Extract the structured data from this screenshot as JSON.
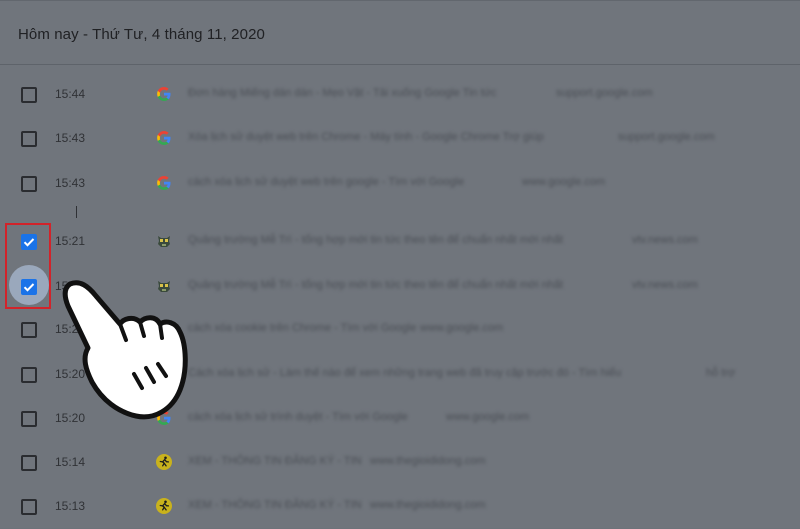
{
  "header": {
    "title": "Hôm nay - Thứ Tư, 4 tháng 11, 2020"
  },
  "rows": [
    {
      "time": "15:44",
      "checked": false,
      "icon": "google-icon",
      "title": "Đơn hàng Miếng dán dán - Mẹo Vặt - Tải xuống Google Tin tức",
      "domain": "support.google.com"
    },
    {
      "time": "15:43",
      "checked": false,
      "icon": "google-icon",
      "title": "Xóa lịch sử duyệt web trên Chrome - Máy tính - Google Chrome Trợ giúp",
      "domain": "support.google.com"
    },
    {
      "time": "15:43",
      "checked": false,
      "icon": "google-icon",
      "title": "cách xóa lịch sử duyệt web trên google - Tìm với Google",
      "domain": "www.google.com"
    },
    {
      "time": "15:21",
      "checked": true,
      "icon": "mascot-icon",
      "title": "Quảng trường Mễ Trì - tổng hợp mới tin tức theo tên để chuẩn nhất mới nhất",
      "domain": "vtv.news.com"
    },
    {
      "time": "15:21",
      "checked": true,
      "icon": "mascot-icon",
      "title": "Quảng trường Mễ Trì - tổng hợp mới tin tức theo tên để chuẩn nhất mới nhất",
      "domain": "vtv.news.com"
    },
    {
      "time": "15:21",
      "checked": false,
      "icon": "google-icon",
      "title": "cách xóa cookie trên Chrome - Tìm với Google",
      "domain": "www.google.com"
    },
    {
      "time": "15:20",
      "checked": false,
      "icon": "google-icon",
      "title": "Cách xóa lịch sử - Làm thế nào để xem những trang web đã truy cập trước đó - Tìm hiểu",
      "domain": "hỗ trợ"
    },
    {
      "time": "15:20",
      "checked": false,
      "icon": "google-icon",
      "title": "cách xóa lịch sử trình duyệt - Tìm với Google",
      "domain": "www.google.com"
    },
    {
      "time": "15:14",
      "checked": false,
      "icon": "runner-icon",
      "title": "XEM - THÔNG TIN ĐĂNG KÝ - TIN",
      "domain": "www.thegioididong.com"
    },
    {
      "time": "15:13",
      "checked": false,
      "icon": "runner-icon",
      "title": "XEM - THÔNG TIN ĐĂNG KÝ - TIN",
      "domain": "www.thegioididong.com"
    }
  ],
  "colors": {
    "accent": "#1a73e8",
    "highlight": "#d2232a",
    "overlay": "#70757c"
  }
}
